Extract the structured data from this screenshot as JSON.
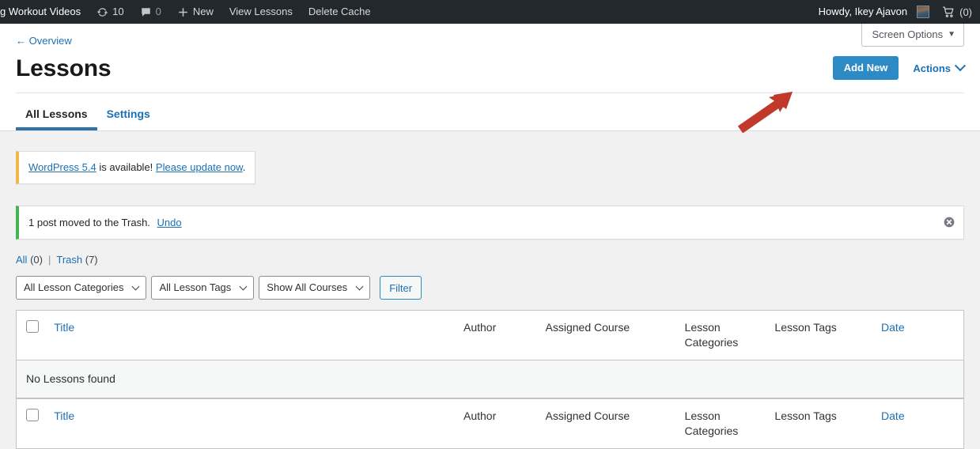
{
  "adminbar": {
    "site_name": "g Workout Videos",
    "updates_icon": "update-icon",
    "updates_count": "10",
    "comments_icon": "comment-icon",
    "comments_count": "0",
    "new_icon": "plus-icon",
    "new_label": "New",
    "view_lessons_label": "View Lessons",
    "delete_cache_label": "Delete Cache",
    "howdy": "Howdy, Ikey Ajavon",
    "avatar_name": "avatar",
    "cart_icon": "cart-icon",
    "cart_count": "(0)"
  },
  "header": {
    "screen_options_label": "Screen Options",
    "screen_options_caret": "▼",
    "overview_link": "← Overview",
    "page_title": "Lessons",
    "add_new_label": "Add New",
    "actions_label": "Actions",
    "tabs": [
      {
        "label": "All Lessons",
        "active": true
      },
      {
        "label": "Settings",
        "active": false
      }
    ]
  },
  "notices": {
    "update": {
      "link_version": "WordPress 5.4",
      "middle": " is available! ",
      "link_update": "Please update now",
      "end": "."
    },
    "trash": {
      "text": "1 post moved to the Trash.",
      "undo_label": "Undo",
      "dismiss_icon": "dismiss-icon"
    }
  },
  "views": {
    "all_label": "All",
    "all_count": "(0)",
    "separator": "|",
    "trash_label": "Trash",
    "trash_count": "(7)"
  },
  "filters": {
    "categories_value": "All Lesson Categories",
    "tags_value": "All Lesson Tags",
    "courses_value": "Show All Courses",
    "filter_button": "Filter"
  },
  "table": {
    "columns": {
      "title": "Title",
      "author": "Author",
      "course": "Assigned Course",
      "categories": "Lesson Categories",
      "tags": "Lesson Tags",
      "date": "Date"
    },
    "empty_message": "No Lessons found"
  },
  "colors": {
    "accent_blue": "#1c70b4",
    "button_blue": "#2e8ac4",
    "adminbar_dark": "#23282d",
    "notice_warning": "#f0b849",
    "notice_success": "#46b450",
    "annotation_red": "#c0392b"
  }
}
